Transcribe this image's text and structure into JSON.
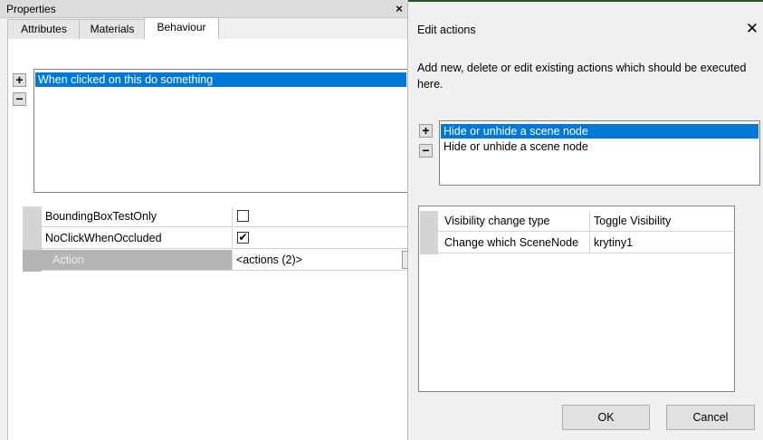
{
  "properties_panel": {
    "title": "Properties",
    "close_glyph": "×",
    "tabs": [
      {
        "label": "Attributes"
      },
      {
        "label": "Materials"
      },
      {
        "label": "Behaviour"
      }
    ],
    "active_tab": "Behaviour",
    "add_glyph": "+",
    "remove_glyph": "−",
    "behaviours": [
      {
        "label": "When clicked on this do something",
        "selected": true
      }
    ],
    "grid": [
      {
        "name": "BoundingBoxTestOnly",
        "value": "",
        "checked": false
      },
      {
        "name": "NoClickWhenOccluded",
        "value": "✔",
        "checked": true
      },
      {
        "name": "Action",
        "value": "<actions (2)>",
        "button": "..."
      }
    ]
  },
  "edit_actions_dialog": {
    "title": "Edit actions",
    "close_glyph": "✕",
    "description": "Add new, delete or edit existing actions which should be executed here.",
    "add_glyph": "+",
    "remove_glyph": "−",
    "actions": [
      {
        "label": "Hide or unhide a scene node",
        "selected": true
      },
      {
        "label": "Hide or unhide a scene node",
        "selected": false
      }
    ],
    "grid": [
      {
        "name": "Visibility change type",
        "value": "Toggle Visibility"
      },
      {
        "name": "Change which SceneNode",
        "value": "krytiny1"
      }
    ],
    "ok_label": "OK",
    "cancel_label": "Cancel"
  }
}
